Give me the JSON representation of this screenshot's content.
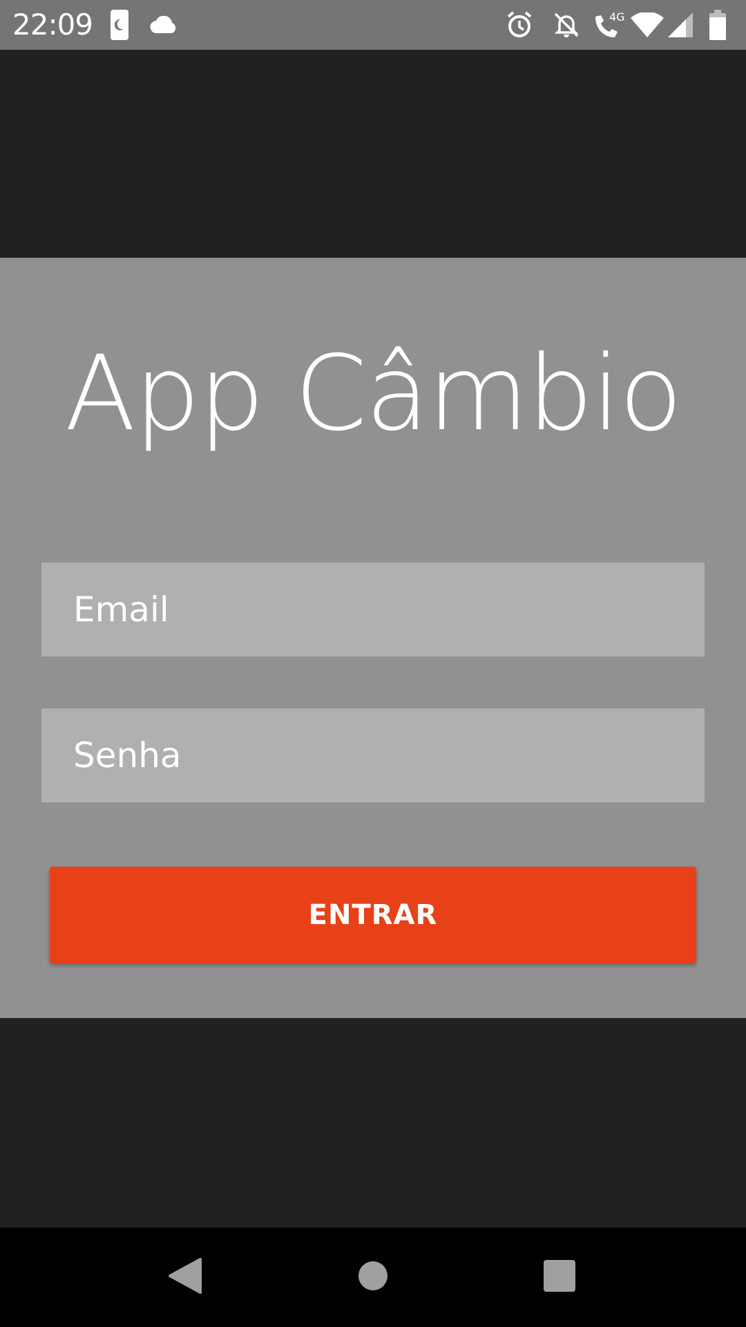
{
  "status_bar": {
    "time": "22:09",
    "network_label": "4G",
    "icons": [
      "dnd-moon-icon",
      "cloud-icon",
      "alarm-icon",
      "notifications-off-icon",
      "wifi-calling-icon",
      "wifi-icon",
      "signal-icon",
      "battery-icon"
    ]
  },
  "app": {
    "title": "App Câmbio"
  },
  "login": {
    "email_placeholder": "Email",
    "password_placeholder": "Senha",
    "submit_label": "ENTRAR",
    "accent_color": "#e84118"
  },
  "nav_bar": {
    "icons": [
      "back-icon",
      "home-icon",
      "recents-icon"
    ]
  }
}
